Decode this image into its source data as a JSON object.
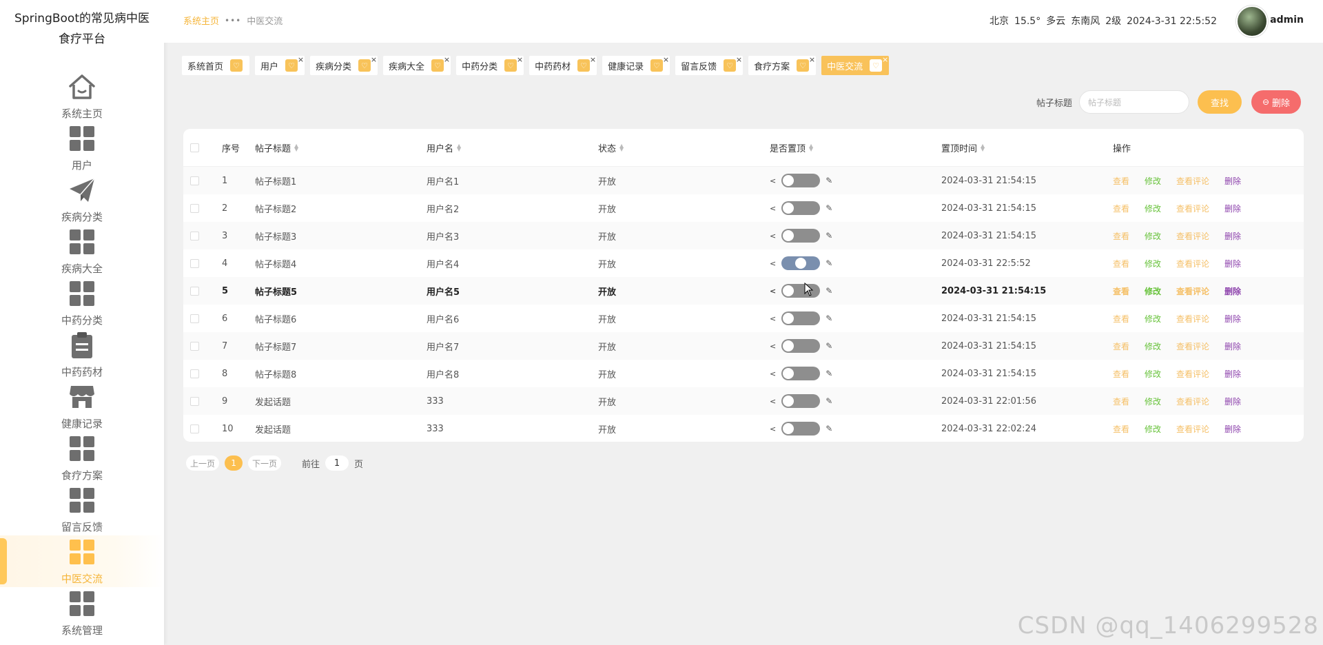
{
  "app": {
    "title_line1": "SpringBoot的常见病中医",
    "title_line2": "食疗平台"
  },
  "sidebar": {
    "items": [
      {
        "label": "系统主页",
        "icon": "home-icon"
      },
      {
        "label": "用户",
        "icon": "grid-icon"
      },
      {
        "label": "疾病分类",
        "icon": "paper-plane-icon"
      },
      {
        "label": "疾病大全",
        "icon": "grid-icon"
      },
      {
        "label": "中药分类",
        "icon": "grid-icon"
      },
      {
        "label": "中药药材",
        "icon": "clipboard-icon"
      },
      {
        "label": "健康记录",
        "icon": "shop-icon"
      },
      {
        "label": "食疗方案",
        "icon": "grid-icon"
      },
      {
        "label": "留言反馈",
        "icon": "grid-icon"
      },
      {
        "label": "中医交流",
        "icon": "grid-icon",
        "active": true
      },
      {
        "label": "系统管理",
        "icon": "grid-icon"
      }
    ]
  },
  "header": {
    "breadcrumb_home": "系统主页",
    "breadcrumb_sep": "•••",
    "breadcrumb_current": "中医交流",
    "weather_city": "北京",
    "weather_temp": "15.5°",
    "weather_cond": "多云",
    "weather_wind": "东南风",
    "weather_level": "2级",
    "datetime": "2024-3-31 22:5:52",
    "username": "admin"
  },
  "tags": [
    {
      "label": "系统首页",
      "closable": false
    },
    {
      "label": "用户",
      "closable": true
    },
    {
      "label": "疾病分类",
      "closable": true
    },
    {
      "label": "疾病大全",
      "closable": true
    },
    {
      "label": "中药分类",
      "closable": true
    },
    {
      "label": "中药药材",
      "closable": true
    },
    {
      "label": "健康记录",
      "closable": true
    },
    {
      "label": "留言反馈",
      "closable": true
    },
    {
      "label": "食疗方案",
      "closable": true
    },
    {
      "label": "中医交流",
      "closable": true,
      "active": true
    }
  ],
  "tag_close": "×",
  "search": {
    "label": "帖子标题",
    "placeholder": "帖子标题",
    "find_button": "查找",
    "delete_button": "删除",
    "delete_icon": "⊖"
  },
  "table": {
    "headers": {
      "no": "序号",
      "title": "帖子标题",
      "user": "用户名",
      "status": "状态",
      "top": "是否置顶",
      "time": "置顶时间",
      "ops": "操作"
    },
    "ops": {
      "view": "查看",
      "edit": "修改",
      "comments": "查看评论",
      "delete": "删除"
    },
    "rows": [
      {
        "no": "1",
        "title": "帖子标题1",
        "user": "用户名1",
        "status": "开放",
        "pinned": false,
        "time": "2024-03-31 21:54:15"
      },
      {
        "no": "2",
        "title": "帖子标题2",
        "user": "用户名2",
        "status": "开放",
        "pinned": false,
        "time": "2024-03-31 21:54:15"
      },
      {
        "no": "3",
        "title": "帖子标题3",
        "user": "用户名3",
        "status": "开放",
        "pinned": false,
        "time": "2024-03-31 21:54:15"
      },
      {
        "no": "4",
        "title": "帖子标题4",
        "user": "用户名4",
        "status": "开放",
        "pinned": true,
        "time": "2024-03-31 22:5:52"
      },
      {
        "no": "5",
        "title": "帖子标题5",
        "user": "用户名5",
        "status": "开放",
        "pinned": false,
        "time": "2024-03-31 21:54:15",
        "hover": true
      },
      {
        "no": "6",
        "title": "帖子标题6",
        "user": "用户名6",
        "status": "开放",
        "pinned": false,
        "time": "2024-03-31 21:54:15"
      },
      {
        "no": "7",
        "title": "帖子标题7",
        "user": "用户名7",
        "status": "开放",
        "pinned": false,
        "time": "2024-03-31 21:54:15"
      },
      {
        "no": "8",
        "title": "帖子标题8",
        "user": "用户名8",
        "status": "开放",
        "pinned": false,
        "time": "2024-03-31 21:54:15"
      },
      {
        "no": "9",
        "title": "发起话题",
        "user": "333",
        "status": "开放",
        "pinned": false,
        "time": "2024-03-31 22:01:56"
      },
      {
        "no": "10",
        "title": "发起话题",
        "user": "333",
        "status": "开放",
        "pinned": false,
        "time": "2024-03-31 22:02:24"
      }
    ]
  },
  "pager": {
    "prev": "上一页",
    "current": "1",
    "next": "下一页",
    "goto_label": "前往",
    "goto_value": "1",
    "goto_unit": "页"
  },
  "watermark": "CSDN @qq_1406299528",
  "colors": {
    "accent": "#fcbf4f",
    "danger": "#f56c6c",
    "edit": "#67c23a",
    "delete": "#8e44ad"
  }
}
